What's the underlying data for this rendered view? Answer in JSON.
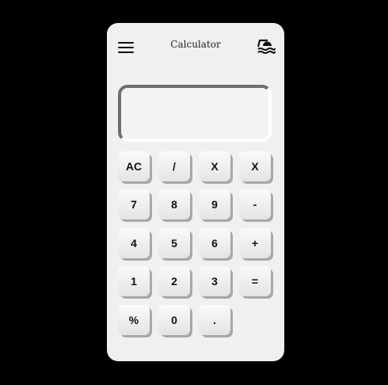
{
  "header": {
    "title": "Calculator",
    "menu_icon": "hamburger-menu-icon",
    "theme_icon": "sun-over-water-icon"
  },
  "display": {
    "value": ""
  },
  "keys": {
    "clear": "AC",
    "divide": "/",
    "multiply": "X",
    "multiply_2": "X",
    "seven": "7",
    "eight": "8",
    "nine": "9",
    "minus": "-",
    "four": "4",
    "five": "5",
    "six": "6",
    "plus": "+",
    "one": "1",
    "two": "2",
    "three": "3",
    "equals": "=",
    "percent": "%",
    "zero": "0",
    "decimal": "."
  },
  "colors": {
    "background": "#000000",
    "panel": "#f0f0f0",
    "key_shadow": "#a8a8a8",
    "display_inset": "#6e6e6e"
  }
}
